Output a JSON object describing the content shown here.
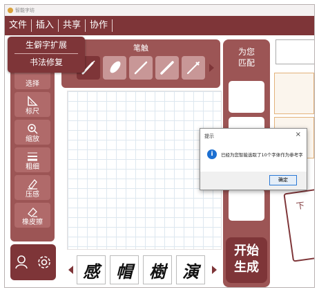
{
  "window": {
    "title": "智能字坊"
  },
  "menu": [
    "文件",
    "插入",
    "共享",
    "协作"
  ],
  "dropdown": [
    "生僻字扩展",
    "书法修复"
  ],
  "tools": [
    {
      "label": "选择",
      "icon": "select-icon"
    },
    {
      "label": "标尺",
      "icon": "ruler-icon"
    },
    {
      "label": "缩放",
      "icon": "zoom-icon"
    },
    {
      "label": "粗细",
      "icon": "thickness-icon"
    },
    {
      "label": "压感",
      "icon": "pressure-icon"
    },
    {
      "label": "橡皮擦",
      "icon": "eraser-icon"
    }
  ],
  "brush": {
    "title": "笔触",
    "items": [
      "brush-1-icon",
      "brush-2-icon",
      "brush-3-icon",
      "brush-4-icon",
      "brush-5-icon"
    ]
  },
  "thumbs": [
    "感",
    "帽",
    "樹",
    "演"
  ],
  "match": {
    "label_line1": "为您",
    "label_line2": "匹配"
  },
  "generate": {
    "line1": "开始",
    "line2": "生成"
  },
  "paper_char": "下",
  "dialog": {
    "title": "提示",
    "message": "已经为您智能选取了10个字体作为参考字",
    "ok": "确定",
    "close": "×"
  },
  "colors": {
    "brand": "#7e3538",
    "panel": "#9c5555"
  }
}
